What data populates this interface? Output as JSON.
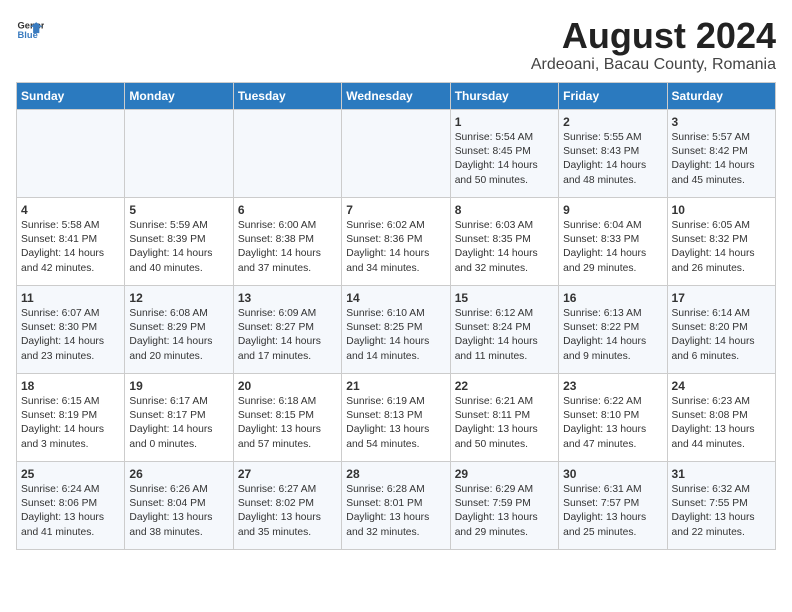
{
  "header": {
    "logo_general": "General",
    "logo_blue": "Blue",
    "title": "August 2024",
    "subtitle": "Ardeoani, Bacau County, Romania"
  },
  "weekdays": [
    "Sunday",
    "Monday",
    "Tuesday",
    "Wednesday",
    "Thursday",
    "Friday",
    "Saturday"
  ],
  "weeks": [
    [
      {
        "day": "",
        "text": ""
      },
      {
        "day": "",
        "text": ""
      },
      {
        "day": "",
        "text": ""
      },
      {
        "day": "",
        "text": ""
      },
      {
        "day": "1",
        "text": "Sunrise: 5:54 AM\nSunset: 8:45 PM\nDaylight: 14 hours\nand 50 minutes."
      },
      {
        "day": "2",
        "text": "Sunrise: 5:55 AM\nSunset: 8:43 PM\nDaylight: 14 hours\nand 48 minutes."
      },
      {
        "day": "3",
        "text": "Sunrise: 5:57 AM\nSunset: 8:42 PM\nDaylight: 14 hours\nand 45 minutes."
      }
    ],
    [
      {
        "day": "4",
        "text": "Sunrise: 5:58 AM\nSunset: 8:41 PM\nDaylight: 14 hours\nand 42 minutes."
      },
      {
        "day": "5",
        "text": "Sunrise: 5:59 AM\nSunset: 8:39 PM\nDaylight: 14 hours\nand 40 minutes."
      },
      {
        "day": "6",
        "text": "Sunrise: 6:00 AM\nSunset: 8:38 PM\nDaylight: 14 hours\nand 37 minutes."
      },
      {
        "day": "7",
        "text": "Sunrise: 6:02 AM\nSunset: 8:36 PM\nDaylight: 14 hours\nand 34 minutes."
      },
      {
        "day": "8",
        "text": "Sunrise: 6:03 AM\nSunset: 8:35 PM\nDaylight: 14 hours\nand 32 minutes."
      },
      {
        "day": "9",
        "text": "Sunrise: 6:04 AM\nSunset: 8:33 PM\nDaylight: 14 hours\nand 29 minutes."
      },
      {
        "day": "10",
        "text": "Sunrise: 6:05 AM\nSunset: 8:32 PM\nDaylight: 14 hours\nand 26 minutes."
      }
    ],
    [
      {
        "day": "11",
        "text": "Sunrise: 6:07 AM\nSunset: 8:30 PM\nDaylight: 14 hours\nand 23 minutes."
      },
      {
        "day": "12",
        "text": "Sunrise: 6:08 AM\nSunset: 8:29 PM\nDaylight: 14 hours\nand 20 minutes."
      },
      {
        "day": "13",
        "text": "Sunrise: 6:09 AM\nSunset: 8:27 PM\nDaylight: 14 hours\nand 17 minutes."
      },
      {
        "day": "14",
        "text": "Sunrise: 6:10 AM\nSunset: 8:25 PM\nDaylight: 14 hours\nand 14 minutes."
      },
      {
        "day": "15",
        "text": "Sunrise: 6:12 AM\nSunset: 8:24 PM\nDaylight: 14 hours\nand 11 minutes."
      },
      {
        "day": "16",
        "text": "Sunrise: 6:13 AM\nSunset: 8:22 PM\nDaylight: 14 hours\nand 9 minutes."
      },
      {
        "day": "17",
        "text": "Sunrise: 6:14 AM\nSunset: 8:20 PM\nDaylight: 14 hours\nand 6 minutes."
      }
    ],
    [
      {
        "day": "18",
        "text": "Sunrise: 6:15 AM\nSunset: 8:19 PM\nDaylight: 14 hours\nand 3 minutes."
      },
      {
        "day": "19",
        "text": "Sunrise: 6:17 AM\nSunset: 8:17 PM\nDaylight: 14 hours\nand 0 minutes."
      },
      {
        "day": "20",
        "text": "Sunrise: 6:18 AM\nSunset: 8:15 PM\nDaylight: 13 hours\nand 57 minutes."
      },
      {
        "day": "21",
        "text": "Sunrise: 6:19 AM\nSunset: 8:13 PM\nDaylight: 13 hours\nand 54 minutes."
      },
      {
        "day": "22",
        "text": "Sunrise: 6:21 AM\nSunset: 8:11 PM\nDaylight: 13 hours\nand 50 minutes."
      },
      {
        "day": "23",
        "text": "Sunrise: 6:22 AM\nSunset: 8:10 PM\nDaylight: 13 hours\nand 47 minutes."
      },
      {
        "day": "24",
        "text": "Sunrise: 6:23 AM\nSunset: 8:08 PM\nDaylight: 13 hours\nand 44 minutes."
      }
    ],
    [
      {
        "day": "25",
        "text": "Sunrise: 6:24 AM\nSunset: 8:06 PM\nDaylight: 13 hours\nand 41 minutes."
      },
      {
        "day": "26",
        "text": "Sunrise: 6:26 AM\nSunset: 8:04 PM\nDaylight: 13 hours\nand 38 minutes."
      },
      {
        "day": "27",
        "text": "Sunrise: 6:27 AM\nSunset: 8:02 PM\nDaylight: 13 hours\nand 35 minutes."
      },
      {
        "day": "28",
        "text": "Sunrise: 6:28 AM\nSunset: 8:01 PM\nDaylight: 13 hours\nand 32 minutes."
      },
      {
        "day": "29",
        "text": "Sunrise: 6:29 AM\nSunset: 7:59 PM\nDaylight: 13 hours\nand 29 minutes."
      },
      {
        "day": "30",
        "text": "Sunrise: 6:31 AM\nSunset: 7:57 PM\nDaylight: 13 hours\nand 25 minutes."
      },
      {
        "day": "31",
        "text": "Sunrise: 6:32 AM\nSunset: 7:55 PM\nDaylight: 13 hours\nand 22 minutes."
      }
    ]
  ]
}
